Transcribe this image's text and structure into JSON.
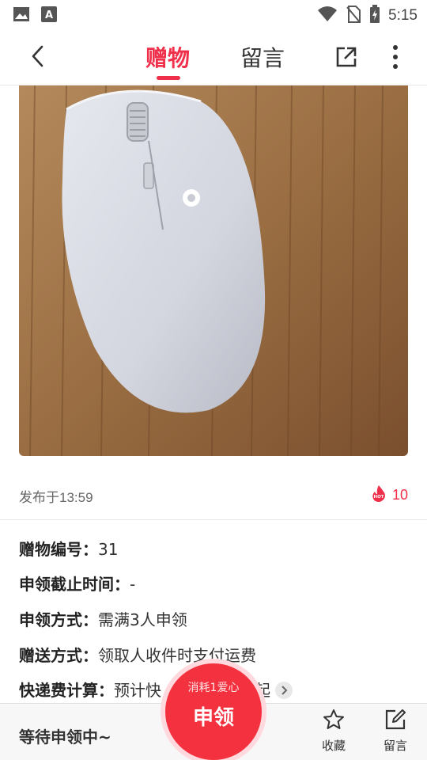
{
  "status_bar": {
    "time": "5:15",
    "icons": [
      "image-icon",
      "font-a-icon",
      "wifi-icon",
      "no-sim-icon",
      "battery-charging-icon"
    ]
  },
  "header": {
    "back_icon": "chevron-left-icon",
    "tabs": [
      {
        "label": "赠物",
        "active": true
      },
      {
        "label": "留言",
        "active": false
      }
    ],
    "share_icon": "external-link-icon",
    "more_icon": "more-vertical-icon"
  },
  "product": {
    "image_subject": "white wireless mouse on wooden table",
    "posted_time": "发布于13:59",
    "hot_badge": "HOT",
    "hot_count": "10"
  },
  "details": {
    "gift_id": {
      "label": "赠物编号：",
      "value": "31"
    },
    "deadline": {
      "label": "申领截止时间：",
      "value": "-"
    },
    "claim_method": {
      "label": "申领方式：",
      "value": "需满3人申领"
    },
    "delivery_method": {
      "label": "赠送方式：",
      "value": "领取人收件时支付运费"
    },
    "shipping_fee": {
      "label": "快递费计算：",
      "value_prefix": "预计快",
      "value_suffix": "元起"
    }
  },
  "bottom_bar": {
    "status": "等待申领中~",
    "claim_button": {
      "sub": "消耗1爱心",
      "label": "申领"
    },
    "favorite": {
      "label": "收藏",
      "icon": "star-icon"
    },
    "comment": {
      "label": "留言",
      "icon": "edit-icon"
    }
  },
  "colors": {
    "accent": "#f0304a",
    "claim_button": "#f4313f"
  }
}
